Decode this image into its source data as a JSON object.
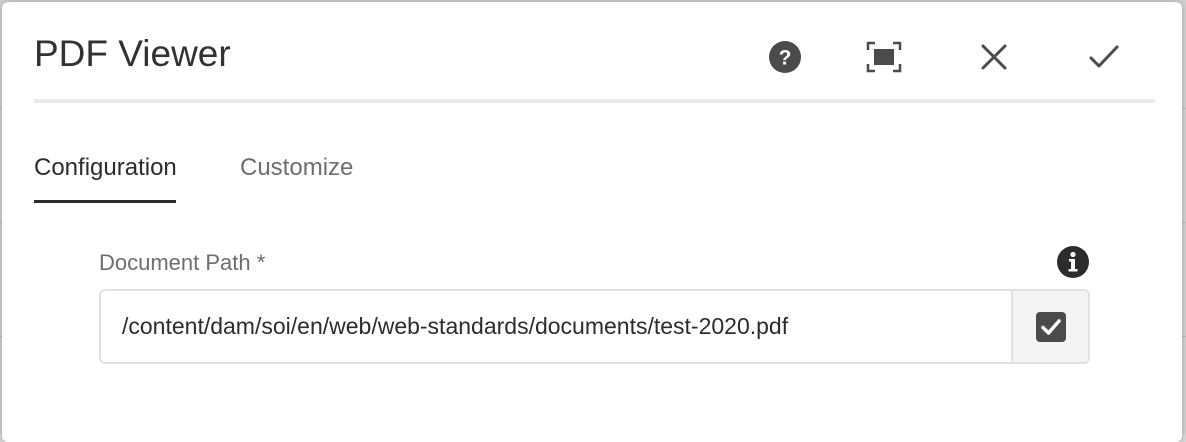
{
  "dialog": {
    "title": "PDF Viewer",
    "actions": {
      "help": "help-icon",
      "fullscreen": "fullscreen-icon",
      "close": "close-icon",
      "confirm": "checkmark-icon"
    }
  },
  "tabs": [
    {
      "label": "Configuration",
      "active": true
    },
    {
      "label": "Customize",
      "active": false
    }
  ],
  "document_path": {
    "label": "Document Path *",
    "value": "/content/dam/soi/en/web/web-standards/documents/test-2020.pdf",
    "info_icon": "info-icon",
    "picker_icon": "checkbox-checked-icon"
  },
  "colors": {
    "text_primary": "#2c2c2c",
    "text_secondary": "#6e6e6e",
    "icon": "#4b4b4b",
    "divider": "#eaeaea",
    "field_border": "#e1e1e1"
  }
}
